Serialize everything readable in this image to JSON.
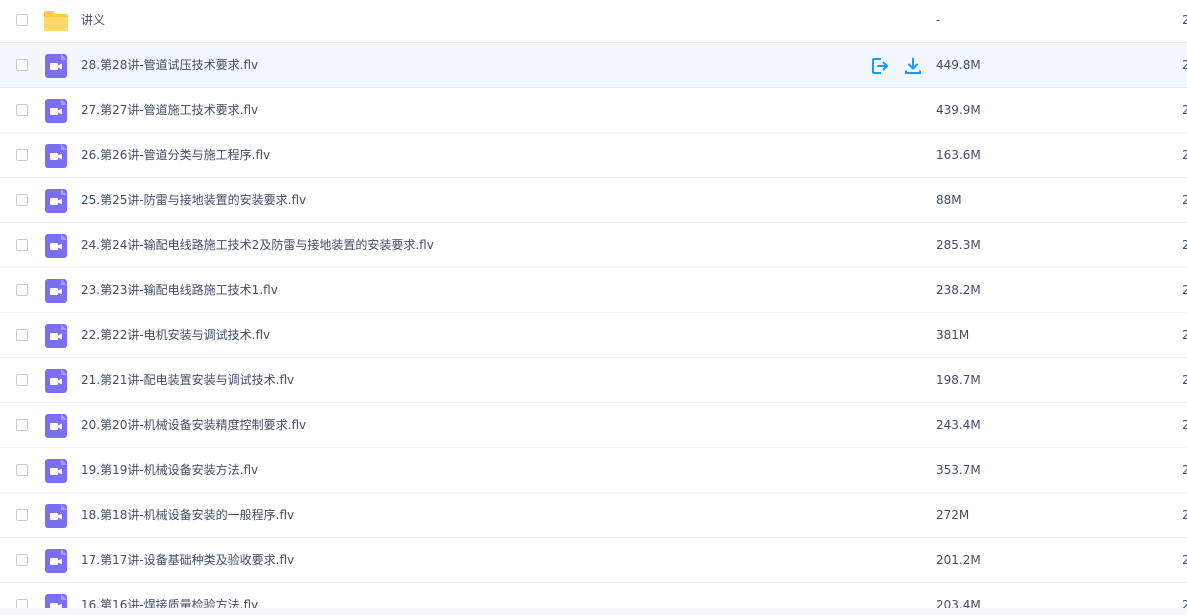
{
  "icons": {
    "folder": "folder-icon",
    "video": "video-file-icon",
    "share": "share-icon",
    "download": "download-icon"
  },
  "colors": {
    "folder": "#ffd65c",
    "video": "#7b6ff0",
    "action": "#1a9aff",
    "hover_row": "#f3f8fe",
    "text": "#424e67"
  },
  "rows": [
    {
      "type": "folder",
      "name": "讲义",
      "size": "-",
      "date": "2"
    },
    {
      "type": "video",
      "name": "28.第28讲-管道试压技术要求.flv",
      "size": "449.8M",
      "date": "2",
      "hovered": true
    },
    {
      "type": "video",
      "name": "27.第27讲-管道施工技术要求.flv",
      "size": "439.9M",
      "date": "2"
    },
    {
      "type": "video",
      "name": "26.第26讲-管道分类与施工程序.flv",
      "size": "163.6M",
      "date": "2"
    },
    {
      "type": "video",
      "name": "25.第25讲-防雷与接地装置的安装要求.flv",
      "size": "88M",
      "date": "2"
    },
    {
      "type": "video",
      "name": "24.第24讲-输配电线路施工技术2及防雷与接地装置的安装要求.flv",
      "size": "285.3M",
      "date": "2"
    },
    {
      "type": "video",
      "name": "23.第23讲-输配电线路施工技术1.flv",
      "size": "238.2M",
      "date": "2"
    },
    {
      "type": "video",
      "name": "22.第22讲-电机安装与调试技术.flv",
      "size": "381M",
      "date": "2"
    },
    {
      "type": "video",
      "name": "21.第21讲-配电装置安装与调试技术.flv",
      "size": "198.7M",
      "date": "2"
    },
    {
      "type": "video",
      "name": "20.第20讲-机械设备安装精度控制要求.flv",
      "size": "243.4M",
      "date": "2"
    },
    {
      "type": "video",
      "name": "19.第19讲-机械设备安装方法.flv",
      "size": "353.7M",
      "date": "2"
    },
    {
      "type": "video",
      "name": "18.第18讲-机械设备安装的一般程序.flv",
      "size": "272M",
      "date": "2"
    },
    {
      "type": "video",
      "name": "17.第17讲-设备基础种类及验收要求.flv",
      "size": "201.2M",
      "date": "2"
    },
    {
      "type": "video",
      "name": "16.第16讲-焊接质量检验方法.flv",
      "size": "203.4M",
      "date": "2"
    }
  ]
}
